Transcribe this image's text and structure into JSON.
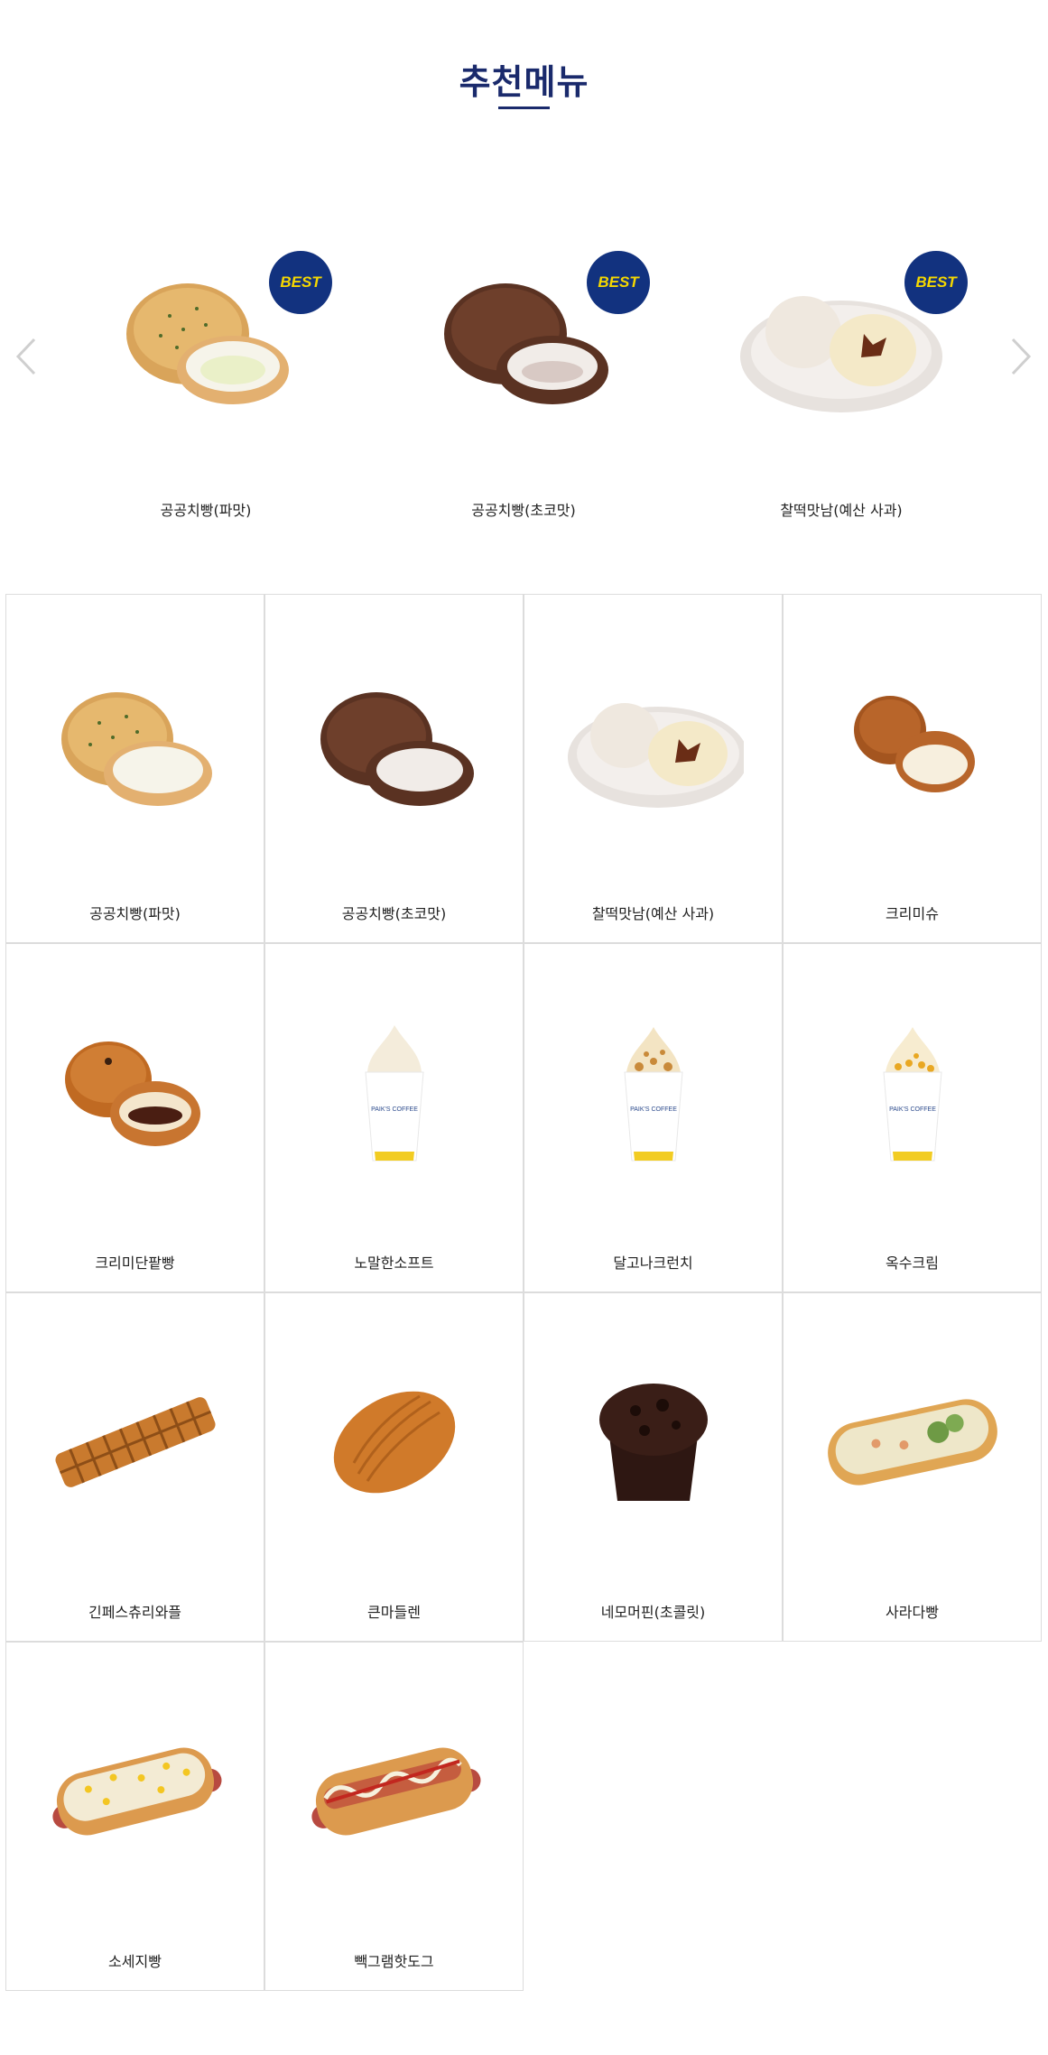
{
  "page": {
    "title": "추천메뉴"
  },
  "carousel": {
    "best_label": "BEST",
    "slides": [
      {
        "name": "공공치빵(파맛)",
        "icon": "pa-bread-image"
      },
      {
        "name": "공공치빵(초코맛)",
        "icon": "choco-bread-image"
      },
      {
        "name": "찰떡맛남(예산 사과)",
        "icon": "rice-cake-bread-image"
      }
    ]
  },
  "menu": {
    "items": [
      {
        "name": "공공치빵(파맛)"
      },
      {
        "name": "공공치빵(초코맛)"
      },
      {
        "name": "찰떡맛남(예산 사과)"
      },
      {
        "name": "크리미슈"
      },
      {
        "name": "크리미단팥빵"
      },
      {
        "name": "노말한소프트"
      },
      {
        "name": "달고나크런치"
      },
      {
        "name": "옥수크림"
      },
      {
        "name": "긴페스츄리와플"
      },
      {
        "name": "큰마들렌"
      },
      {
        "name": "네모머핀(초콜릿)"
      },
      {
        "name": "사라다빵"
      },
      {
        "name": "소세지빵"
      },
      {
        "name": "빽그램핫도그"
      }
    ]
  },
  "cup_brand": "PAIK'S COFFEE",
  "colors": {
    "title": "#1a2a6c",
    "badge_bg": "#12327f",
    "badge_text": "#f5d800",
    "border": "#dcdcdc"
  }
}
